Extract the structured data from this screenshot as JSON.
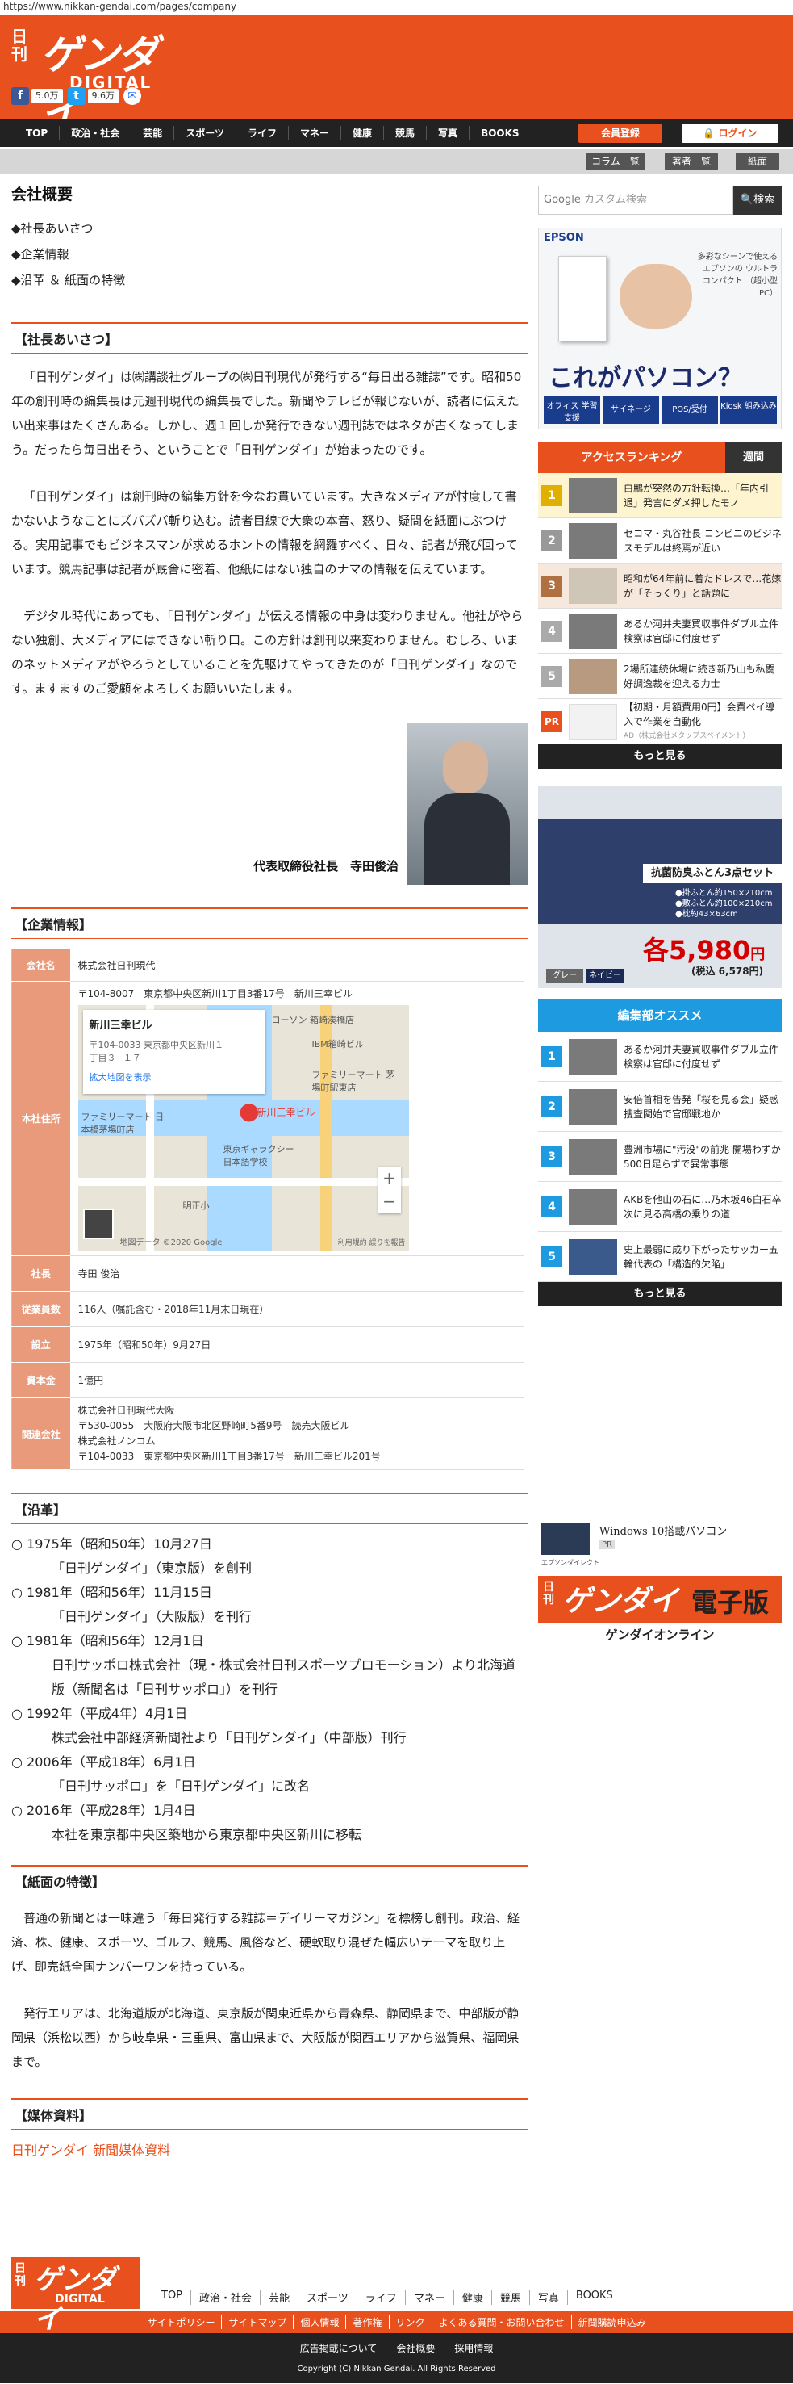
{
  "url": "https://www.nikkan-gendai.com/pages/company",
  "brand": {
    "nikkan": "日刊",
    "gendai": "ゲンダイ",
    "digital": "DIGITAL",
    "accent": "#e8501e"
  },
  "shares": {
    "fb_count": "5.0万",
    "tw_count": "9.6万"
  },
  "nav": {
    "items": [
      "TOP",
      "政治・社会",
      "芸能",
      "スポーツ",
      "ライフ",
      "マネー",
      "健康",
      "競馬",
      "写真",
      "BOOKS"
    ],
    "register": "会員登録",
    "login": "ログイン"
  },
  "subnav": [
    "コラム一覧",
    "著者一覧",
    "紙面"
  ],
  "page": {
    "title": "会社概要",
    "toc": [
      "◆社長あいさつ",
      "◆企業情報",
      "◆沿革 ＆ 紙面の特徴"
    ]
  },
  "greeting": {
    "heading": "【社長あいさつ】",
    "p1": "「日刊ゲンダイ」は㈱講談社グループの㈱日刊現代が発行する“毎日出る雑誌”です。昭和50年の創刊時の編集長は元週刊現代の編集長でした。新聞やテレビが報じないが、読者に伝えたい出来事はたくさんある。しかし、週１回しか発行できない週刊誌ではネタが古くなってしまう。だったら毎日出そう、ということで「日刊ゲンダイ」が始まったのです。",
    "p2": "「日刊ゲンダイ」は創刊時の編集方針を今なお貫いています。大きなメディアが忖度して書かないようなことにズバズバ斬り込む。読者目線で大衆の本音、怒り、疑問を紙面にぶつける。実用記事でもビジネスマンが求めるホントの情報を網羅すべく、日々、記者が飛び回っています。競馬記事は記者が厩舎に密着、他紙にはない独自のナマの情報を伝えています。",
    "p3": "デジタル時代にあっても、「日刊ゲンダイ」が伝える情報の中身は変わりません。他社がやらない独創、大メディアにはできない斬り口。この方針は創刊以来変わりません。むしろ、いまのネットメディアがやろうとしていることを先駆けてやってきたのが「日刊ゲンダイ」なのです。ますますのご愛顧をよろしくお願いいたします。",
    "signature": "代表取締役社長　寺田俊治"
  },
  "company": {
    "heading": "【企業情報】",
    "rows": [
      {
        "k": "会社名",
        "v": "株式会社日刊現代"
      },
      {
        "k": "本社住所",
        "v": "〒104-8007　東京都中央区新川1丁目3番17号　新川三幸ビル"
      },
      {
        "k": "社長",
        "v": "寺田 俊治"
      },
      {
        "k": "従業員数",
        "v": "116人（嘱託含む・2018年11月末日現在）"
      },
      {
        "k": "設立",
        "v": "1975年（昭和50年）9月27日"
      },
      {
        "k": "資本金",
        "v": "1億円"
      },
      {
        "k": "関連会社",
        "v": [
          "株式会社日刊現代大阪",
          "〒530-0055　大阪府大阪市北区野崎町5番9号　読売大阪ビル",
          "株式会社ノンコム",
          "〒104-0033　東京都中央区新川1丁目3番17号　新川三幸ビル201号"
        ]
      }
    ],
    "map": {
      "place": "新川三幸ビル",
      "addr": "〒104-0033 東京都中央区新川１丁目３−１７",
      "link": "拡大地図を表示",
      "pin": "新川三幸ビル",
      "l1": "ローソン 箱崎湊橋店",
      "l2": "IBM箱崎ビル",
      "l3": "ファミリーマート 茅場町駅東店",
      "l4": "ファミリーマート 日本橋茅場町店",
      "l5": "東京ギャラクシー 日本語学校",
      "l6": "明正小",
      "credit": "地図データ ©2020 Google",
      "terms": "利用規約 誤りを報告"
    }
  },
  "history": {
    "heading": "【沿革】",
    "items": [
      {
        "y": "○ 1975年（昭和50年）10月27日",
        "d": "「日刊ゲンダイ」（東京版）を創刊"
      },
      {
        "y": "○ 1981年（昭和56年）11月15日",
        "d": "「日刊ゲンダイ」（大阪版）を刊行"
      },
      {
        "y": "○ 1981年（昭和56年）12月1日",
        "d": "日刊サッポロ株式会社（現・株式会社日刊スポーツプロモーション）より北海道版（新聞名は「日刊サッポロ」）を刊行"
      },
      {
        "y": "○ 1992年（平成4年）4月1日",
        "d": "株式会社中部経済新聞社より「日刊ゲンダイ」（中部版）刊行"
      },
      {
        "y": "○ 2006年（平成18年）6月1日",
        "d": "「日刊サッポロ」を「日刊ゲンダイ」に改名"
      },
      {
        "y": "○ 2016年（平成28年）1月4日",
        "d": "本社を東京都中央区築地から東京都中央区新川に移転"
      }
    ]
  },
  "features": {
    "heading": "【紙面の特徴】",
    "p1": "普通の新聞とは一味違う「毎日発行する雑誌＝デイリーマガジン」を標榜し創刊。政治、経済、株、健康、スポーツ、ゴルフ、競馬、風俗など、硬軟取り混ぜた幅広いテーマを取り上げ、即売紙全国ナンバーワンを持っている。",
    "p2": "発行エリアは、北海道版が北海道、東京版が関東近県から青森県、静岡県まで、中部版が静岡県（浜松以西）から岐阜県・三重県、富山県まで、大阪版が関西エリアから滋賀県、福岡県まで。"
  },
  "media": {
    "heading": "【媒体資料】",
    "link": "日刊ゲンダイ 新聞媒体資料"
  },
  "sidebar": {
    "search_placeholder": "カスタム検索",
    "search_brand": "Google",
    "search_button": "検索",
    "ad1": {
      "brand": "EPSON",
      "note": "多彩なシーンで使える エプソンの ウルトラコンパクト （超小型PC）",
      "headline": "これがパソコン？",
      "chips": [
        "オフィス 学習支援",
        "サイネージ",
        "POS/受付",
        "Kiosk 組み込み"
      ]
    },
    "ranking": {
      "tab_active": "アクセスランキング",
      "tab_week": "週間",
      "items": [
        {
          "n": "1",
          "t": "白鵬が突然の方針転換…「年内引退」発言にダメ押したモノ"
        },
        {
          "n": "2",
          "t": "セコマ・丸谷社長 コンビニのビジネスモデルは終焉が近い"
        },
        {
          "n": "3",
          "t": "昭和が64年前に着たドレスで…花嫁が「そっくり」と話題に"
        },
        {
          "n": "4",
          "t": "あるか河井夫妻買収事件ダブル立件 検察は官邸に付度せず"
        },
        {
          "n": "5",
          "t": "2場所連続休場に続き新乃山も私闘好調逸裁を迎える力士"
        }
      ],
      "pr": {
        "t": "【初期・月額費用0円】会費ペイ導入で作業を自動化",
        "ad": "AD（株式会社メタップスペイメント）"
      },
      "more": "もっと見る"
    },
    "ad2": {
      "title": "抗菌防臭ふとん3点セット",
      "spec1": "●掛ふとん約150×210cm",
      "spec2": "●敷ふとん約100×210cm",
      "spec3": "●枕約43×63cm",
      "price": "各5,980",
      "yen": "円",
      "tax": "(税込 6,578円)",
      "colors": [
        "グレー",
        "ネイビー"
      ]
    },
    "pick": {
      "title": "編集部オススメ",
      "items": [
        {
          "n": "1",
          "t": "あるか河井夫妻買収事件ダブル立件 検察は官邸に付度せず"
        },
        {
          "n": "2",
          "t": "安倍首相を告発「桜を見る会」疑惑 捜査関始で官邸戦地か"
        },
        {
          "n": "3",
          "t": "豊洲市場に\"汚没\"の前兆 開場わずか500日足らずで異常事態"
        },
        {
          "n": "4",
          "t": "AKBを他山の石に…乃木坂46白石卒次に見る高橋の乗りの道"
        },
        {
          "n": "5",
          "t": "史上最弱に成り下がったサッカー五輪代表の「構造的欠陥」"
        }
      ],
      "more": "もっと見る"
    },
    "ad3": {
      "t": "Windows 10搭載パソコン",
      "pr": "PR",
      "brand": "エプソンダイレクト"
    },
    "ebook": {
      "nk": "日刊",
      "gd": "ゲンダイ",
      "label": "電子版",
      "sub": "ゲンダイオンライン"
    }
  },
  "footer": {
    "nav": [
      "TOP",
      "政治・社会",
      "芸能",
      "スポーツ",
      "ライフ",
      "マネー",
      "健康",
      "競馬",
      "写真",
      "BOOKS"
    ],
    "links": [
      "サイトポリシー",
      "サイトマップ",
      "個人情報",
      "著作権",
      "リンク",
      "よくある質問・お問い合わせ",
      "新聞購読申込み"
    ],
    "links2": [
      "広告掲載について",
      "会社概要",
      "採用情報"
    ],
    "copyright": "Copyright (C) Nikkan Gendai. All Rights Reserved"
  }
}
